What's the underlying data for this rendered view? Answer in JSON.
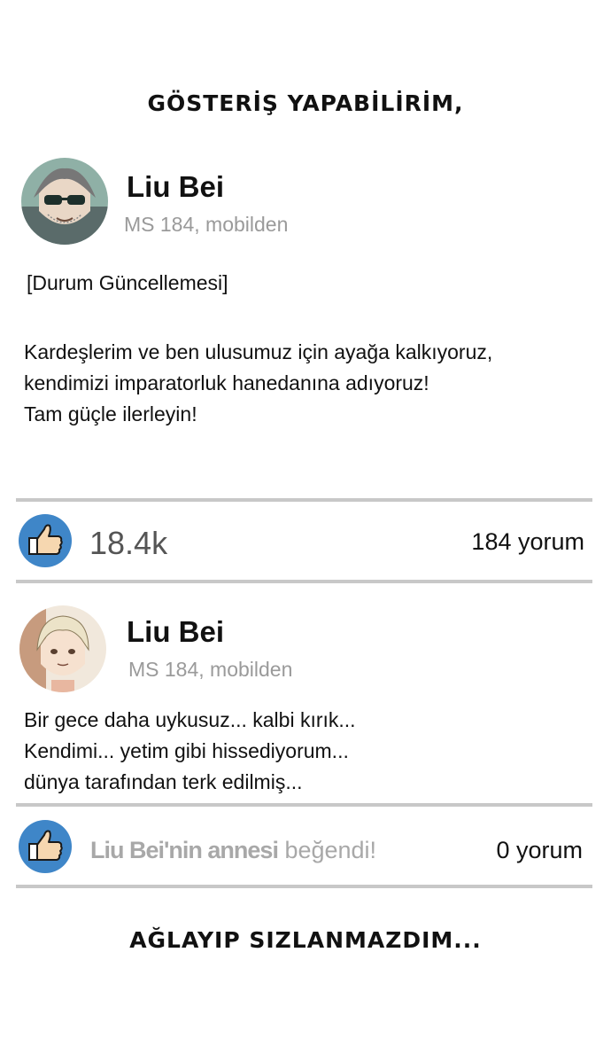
{
  "caption_top": "GÖSTERİŞ YAPABİLİRİM,",
  "caption_bottom": "AĞLAYIP SIZLANMAZDIM...",
  "post1": {
    "author": "Liu Bei",
    "meta": "MS 184, mobilden",
    "tag": "[Durum Güncellemesi]",
    "body": "Kardeşlerim ve ben ulusumuz için ayağa kalkıyoruz,\nkendimizi imparatorluk hanedanına adıyoruz!\nTam güçle ilerleyin!",
    "likes": "18.4k",
    "comments": "184 yorum"
  },
  "post2": {
    "author": "Liu Bei",
    "meta": "MS 184, mobilden",
    "body": "Bir gece daha uykusuz... kalbi kırık...\nKendimi... yetim gibi hissediyorum...\ndünya tarafından terk edilmiş...",
    "liked_by_name": "Liu Bei'nin annesi",
    "liked_by_suffix": " beğendi!",
    "comments": "0 yorum"
  },
  "colors": {
    "like_blue": "#3f86c8",
    "divider": "#c8c8c8",
    "meta_gray": "#9a9a9a"
  },
  "icons": [
    "thumbs-up-icon"
  ]
}
